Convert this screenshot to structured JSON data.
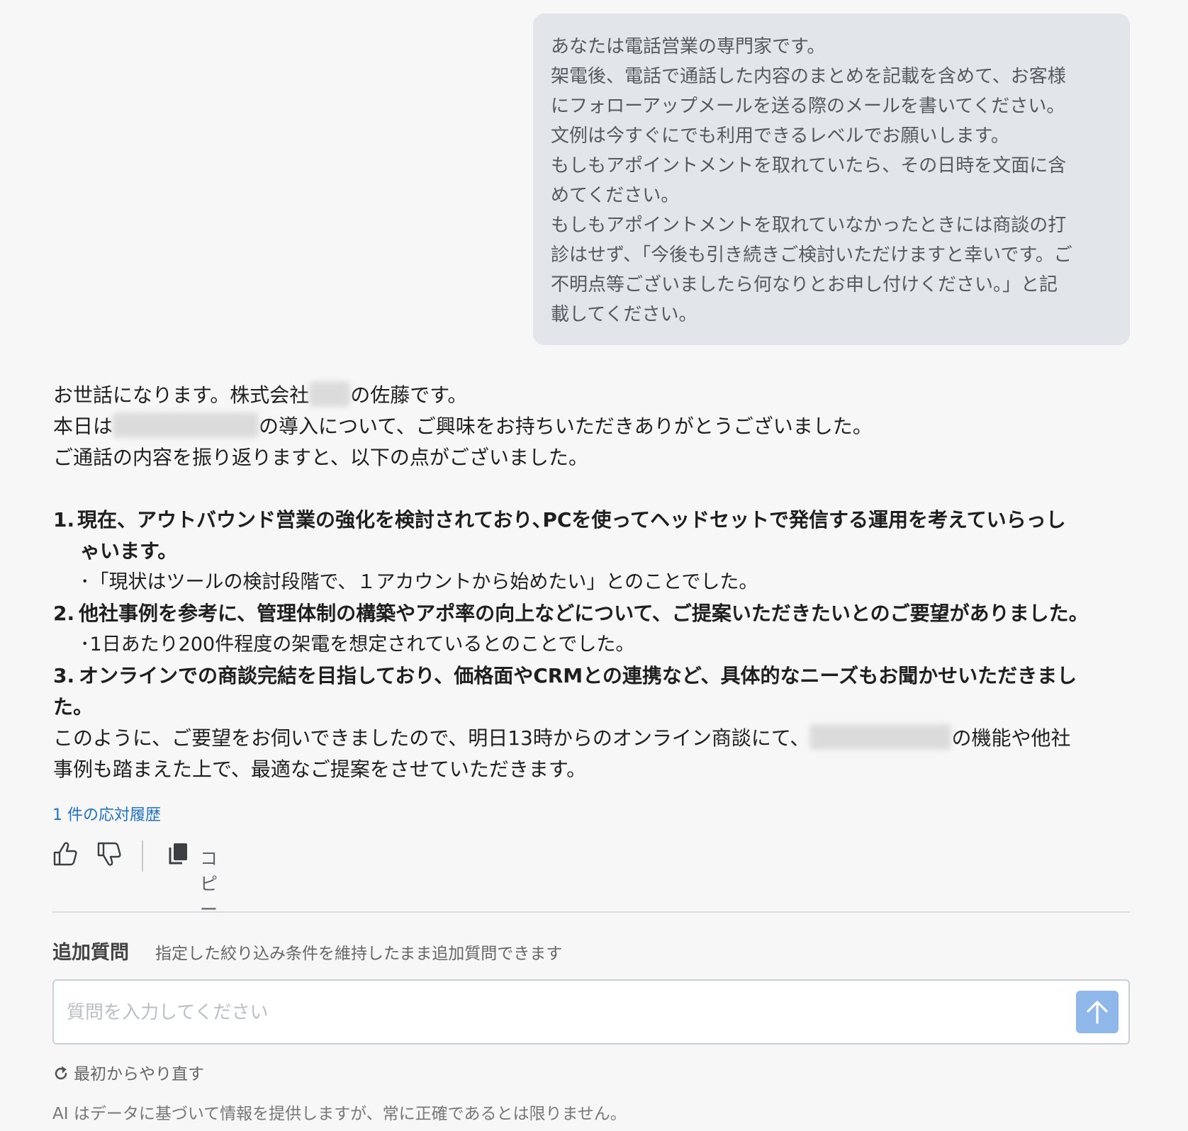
{
  "user_message": {
    "lines": [
      "あなたは電話営業の専門家です。",
      "架電後、電話で通話した内容のまとめを記載を含めて、お客様",
      "にフォローアップメールを送る際のメールを書いてください。",
      "文例は今すぐにでも利用できるレベルでお願いします。",
      "もしもアポイントメントを取れていたら、その日時を文面に含",
      "めてください。",
      "もしもアポイントメントを取れていなかったときには商談の打",
      "診はせず、「今後も引き続きご検討いただけますと幸いです。ご",
      "不明点等ございましたら何なりとお申し付けください。」と記",
      "載してください。"
    ]
  },
  "answer": {
    "greeting_pre": "お世話になります。株式会社",
    "greeting_post": "の佐藤です。",
    "thanks_pre": "本日は",
    "thanks_post": "の導入について、ご興味をお持ちいただきありがとうございました。",
    "recap_intro": "ご通話の内容を振り返りますと、以下の点がございました。",
    "items": [
      {
        "number": "1.",
        "title": "現在、アウトバウンド営業の強化を検討されており､PCを使ってヘッドセットで発信する運用を考えていらっし",
        "title_cont": "ゃいます。",
        "note": "･「現状はツールの検討段階で、１アカウントから始めたい」とのことでした。"
      },
      {
        "number": "2.",
        "title": "他社事例を参考に、管理体制の構築やアポ率の向上などについて、ご提案いただきたいとのご要望がありました。",
        "note": "･1日あたり200件程度の架電を想定されているとのことでした。"
      },
      {
        "number": "3.",
        "title": "オンラインでの商談完結を目指しており、価格面やCRMとの連携など、具体的なニーズもお聞かせいただきまし",
        "title_cont": "た。"
      }
    ],
    "closing_pre": "このように、ご要望をお伺いできましたので、明日13時からのオンライン商談にて、",
    "closing_post": "の機能や他社",
    "closing_line2": "事例も踏まえた上で、最適なご提案をさせていただきます。"
  },
  "history_link": "1 件の応対履歴",
  "actions": {
    "thumbs_up_icon": "thumbs-up-icon",
    "thumbs_down_icon": "thumbs-down-icon",
    "copy_icon": "copy-icon",
    "copy_label": "コピー"
  },
  "followup": {
    "title": "追加質問",
    "description": "指定した絞り込み条件を維持したまま追加質問できます",
    "input_placeholder": "質問を入力してください",
    "input_value": "",
    "send_icon": "arrow-up-icon"
  },
  "restart_label": "最初からやり直す",
  "disclaimer": "AI はデータに基づいて情報を提供しますが、常に正確であるとは限りません。",
  "colors": {
    "background": "#f7f7f7",
    "user_bubble": "#e2e5e9",
    "link": "#1f72c9",
    "send_button": "#8fb7ea"
  }
}
